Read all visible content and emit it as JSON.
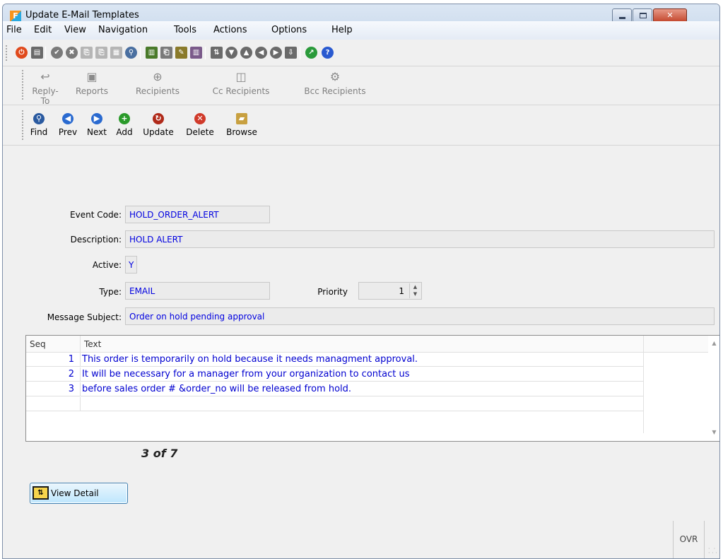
{
  "window": {
    "title": "Update E-Mail Templates",
    "app_icon_letter": "F"
  },
  "menu": [
    "File",
    "Edit",
    "View",
    "Navigation",
    "Tools",
    "Actions",
    "Options",
    "Help"
  ],
  "toolbar_icons": [
    {
      "name": "power-icon",
      "color": "#e04a1c",
      "glyph": "⏻"
    },
    {
      "name": "save-icon",
      "color": "#6a6a6a",
      "glyph": "▤"
    },
    {
      "name": "approve-icon",
      "color": "#7a7a7a",
      "glyph": "✔"
    },
    {
      "name": "cancel-icon",
      "color": "#7a7a7a",
      "glyph": "✖"
    },
    {
      "name": "copy-icon",
      "color": "#b5b5b5",
      "glyph": "⎘"
    },
    {
      "name": "paste-icon",
      "color": "#b5b5b5",
      "glyph": "⎘"
    },
    {
      "name": "select-icon",
      "color": "#b5b5b5",
      "glyph": "▦"
    },
    {
      "name": "zoom-icon",
      "color": "#4a6fa0",
      "glyph": "⚲"
    },
    {
      "name": "calendar-icon",
      "color": "#4a7a2a",
      "glyph": "▥"
    },
    {
      "name": "attach-icon",
      "color": "#7a7a7a",
      "glyph": "⎗"
    },
    {
      "name": "note-icon",
      "color": "#8a7a2a",
      "glyph": "✎"
    },
    {
      "name": "calendar-check-icon",
      "color": "#7a5a8a",
      "glyph": "▥"
    },
    {
      "name": "import-icon",
      "color": "#6a6a6a",
      "glyph": "⇅"
    },
    {
      "name": "down-icon",
      "color": "#6a6a6a",
      "glyph": "▼"
    },
    {
      "name": "up-icon",
      "color": "#6a6a6a",
      "glyph": "▲"
    },
    {
      "name": "prev-record-icon",
      "color": "#6a6a6a",
      "glyph": "◀"
    },
    {
      "name": "next-record-icon",
      "color": "#6a6a6a",
      "glyph": "▶"
    },
    {
      "name": "export-icon",
      "color": "#6a6a6a",
      "glyph": "⇩"
    },
    {
      "name": "chart-icon",
      "color": "#2a9a3a",
      "glyph": "↗"
    },
    {
      "name": "help-icon",
      "color": "#2a5ad0",
      "glyph": "?"
    }
  ],
  "toolbar_recipients": [
    {
      "name": "reply-to",
      "label": "Reply-To",
      "icon": "↩"
    },
    {
      "name": "reports",
      "label": "Reports",
      "icon": "▣"
    },
    {
      "name": "recipients",
      "label": "Recipients",
      "icon": "⊕"
    },
    {
      "name": "cc-recipients",
      "label": "Cc Recipients",
      "icon": "◫"
    },
    {
      "name": "bcc-recipients",
      "label": "Bcc Recipients",
      "icon": "⚙"
    }
  ],
  "toolbar_nav": [
    {
      "name": "find",
      "label": "Find",
      "icon": "⚲",
      "color": "#2a5aa0"
    },
    {
      "name": "prev",
      "label": "Prev",
      "icon": "◀",
      "color": "#2a6ad0"
    },
    {
      "name": "next",
      "label": "Next",
      "icon": "▶",
      "color": "#2a6ad0"
    },
    {
      "name": "add",
      "label": "Add",
      "icon": "+",
      "color": "#2a9a2a"
    },
    {
      "name": "update",
      "label": "Update",
      "icon": "↻",
      "color": "#b02a1a"
    },
    {
      "name": "delete",
      "label": "Delete",
      "icon": "✕",
      "color": "#d03a2a"
    },
    {
      "name": "browse",
      "label": "Browse",
      "icon": "▰",
      "color": "#c8a040"
    }
  ],
  "form": {
    "event_code_label": "Event Code:",
    "event_code": "HOLD_ORDER_ALERT",
    "description_label": "Description:",
    "description": "HOLD ALERT",
    "active_label": "Active:",
    "active": "Y",
    "type_label": "Type:",
    "type": "EMAIL",
    "priority_label": "Priority",
    "priority": "1",
    "subject_label": "Message Subject:",
    "subject": "Order on hold pending approval"
  },
  "grid": {
    "columns": [
      "Seq",
      "Text"
    ],
    "rows": [
      {
        "seq": "1",
        "text": "This order is temporarily on hold because it needs managment approval."
      },
      {
        "seq": "2",
        "text": "It will be necessary for a manager from  your organization to contact us"
      },
      {
        "seq": "3",
        "text": "before sales order # &order_no will be released from hold."
      },
      {
        "seq": "",
        "text": ""
      }
    ]
  },
  "record_count": "3 of 7",
  "view_detail_label": "View Detail",
  "status": {
    "mode": "OVR"
  }
}
